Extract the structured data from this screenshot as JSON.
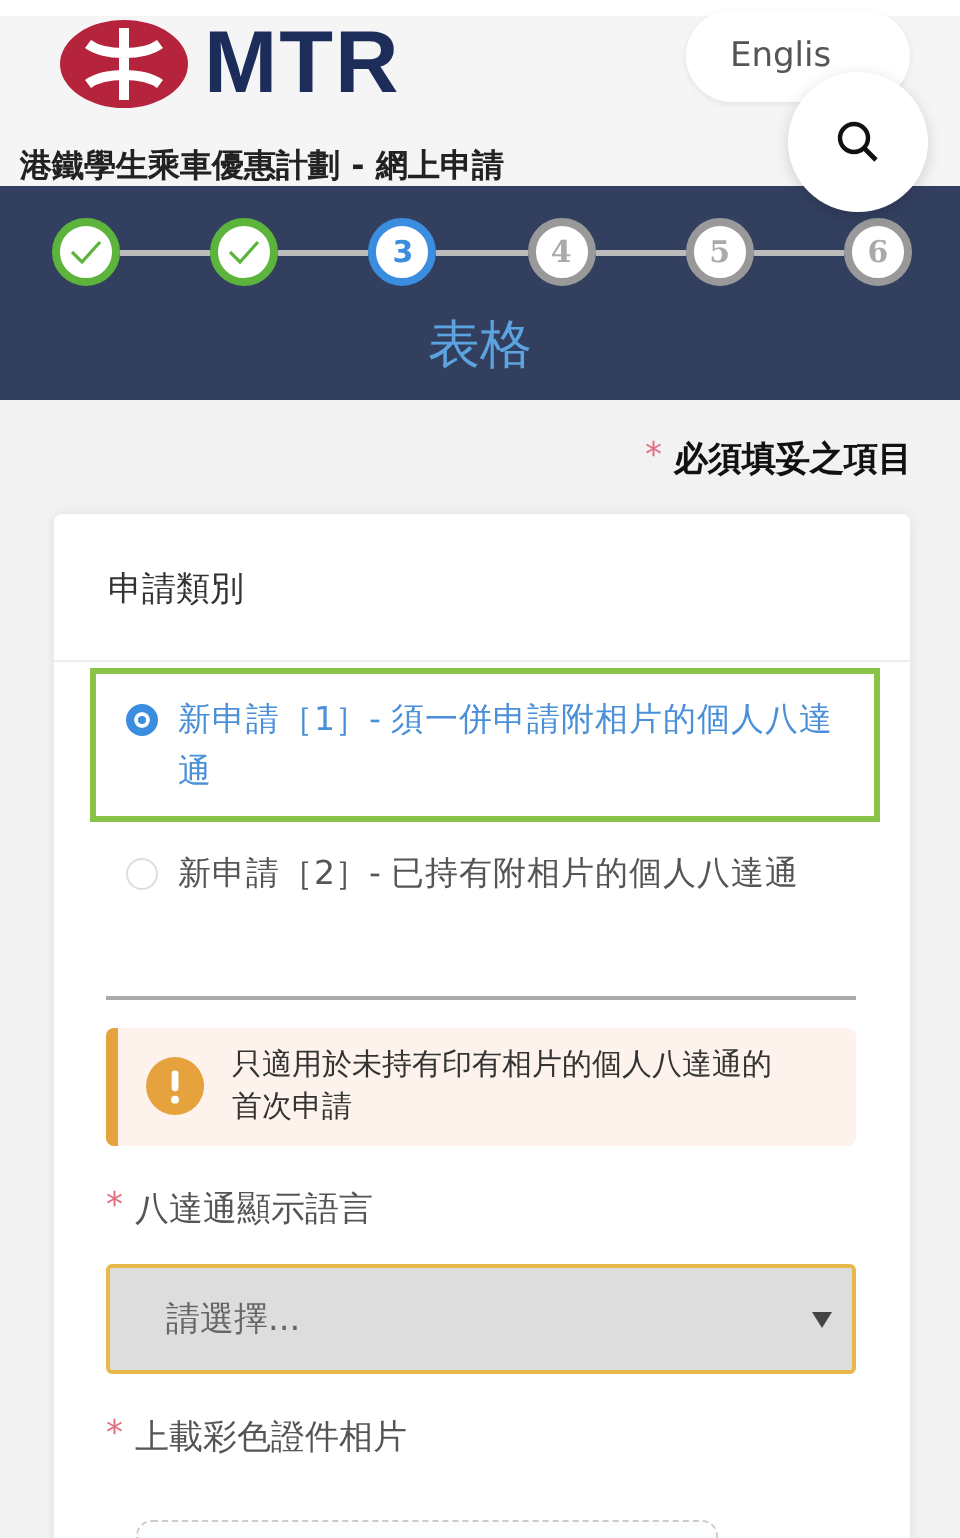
{
  "header": {
    "logo_text": "MTR",
    "language_button": "Englis",
    "title": "港鐵學生乘車優惠計劃 - 網上申請"
  },
  "steps": [
    {
      "done": true,
      "current": false
    },
    {
      "done": true,
      "current": false
    },
    {
      "done": false,
      "current": true,
      "number": "3"
    },
    {
      "done": false,
      "current": false,
      "number": "4"
    },
    {
      "done": false,
      "current": false,
      "number": "5"
    },
    {
      "done": false,
      "current": false,
      "number": "6"
    }
  ],
  "step_title": "表格",
  "required_note": {
    "mark": "*",
    "text": "必須填妥之項目"
  },
  "form": {
    "section_title": "申請類別",
    "options": [
      {
        "label": "新申請［1］- 須一併申請附相片的個人八達通",
        "selected": true
      },
      {
        "label": "新申請［2］- 已持有附相片的個人八達通",
        "selected": false
      }
    ],
    "alert": "只適用於未持有印有相片的個人八達通的首次申請",
    "fields": [
      {
        "kind": "select",
        "mark": "*",
        "label": "八達通顯示語言",
        "placeholder": "請選擇..."
      },
      {
        "kind": "upload",
        "mark": "*",
        "label": "上載彩色證件相片"
      }
    ]
  }
}
